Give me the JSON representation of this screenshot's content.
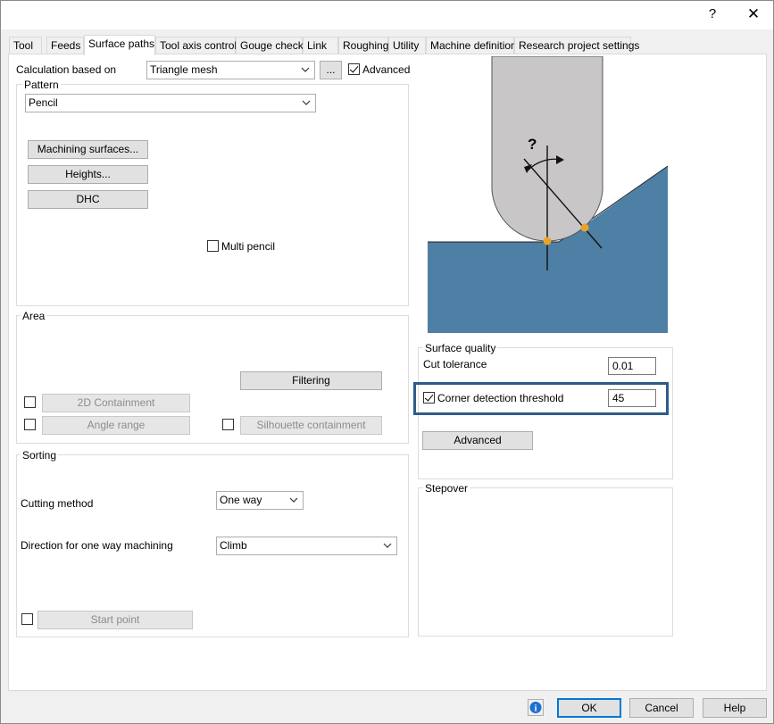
{
  "titlebar": {
    "help": "?",
    "close": "✕"
  },
  "tabs": [
    "Tool",
    "Feeds",
    "Surface paths",
    "Tool axis control",
    "Gouge check",
    "Link",
    "Roughing",
    "Utility",
    "Machine definition",
    "Research project settings"
  ],
  "calc": {
    "label": "Calculation based on",
    "value": "Triangle mesh",
    "more": "...",
    "advanced_label": "Advanced",
    "advanced_checked": true
  },
  "pattern": {
    "title": "Pattern",
    "value": "Pencil",
    "machining_surfaces": "Machining surfaces...",
    "heights": "Heights...",
    "dhc": "DHC",
    "multi_pencil": "Multi pencil"
  },
  "area": {
    "title": "Area",
    "filtering": "Filtering",
    "containment_2d": "2D Containment",
    "angle_range": "Angle range",
    "silhouette": "Silhouette containment"
  },
  "sorting": {
    "title": "Sorting",
    "cutting_method_label": "Cutting method",
    "cutting_method_value": "One way",
    "direction_label": "Direction for one way machining",
    "direction_value": "Climb",
    "start_point": "Start point"
  },
  "illustration": {
    "question_mark": "?"
  },
  "surface_quality": {
    "title": "Surface quality",
    "cut_tolerance_label": "Cut tolerance",
    "cut_tolerance_value": "0.01",
    "corner_label": "Corner detection threshold",
    "corner_value": "45",
    "corner_checked": true,
    "advanced": "Advanced"
  },
  "stepover": {
    "title": "Stepover"
  },
  "footer": {
    "ok": "OK",
    "cancel": "Cancel",
    "help": "Help",
    "info_icon": "i"
  },
  "colors": {
    "highlight": "#2f5b8a",
    "material": "#4e7fa4",
    "tool": "#c8c6c6",
    "contact": "#e8a42a"
  }
}
